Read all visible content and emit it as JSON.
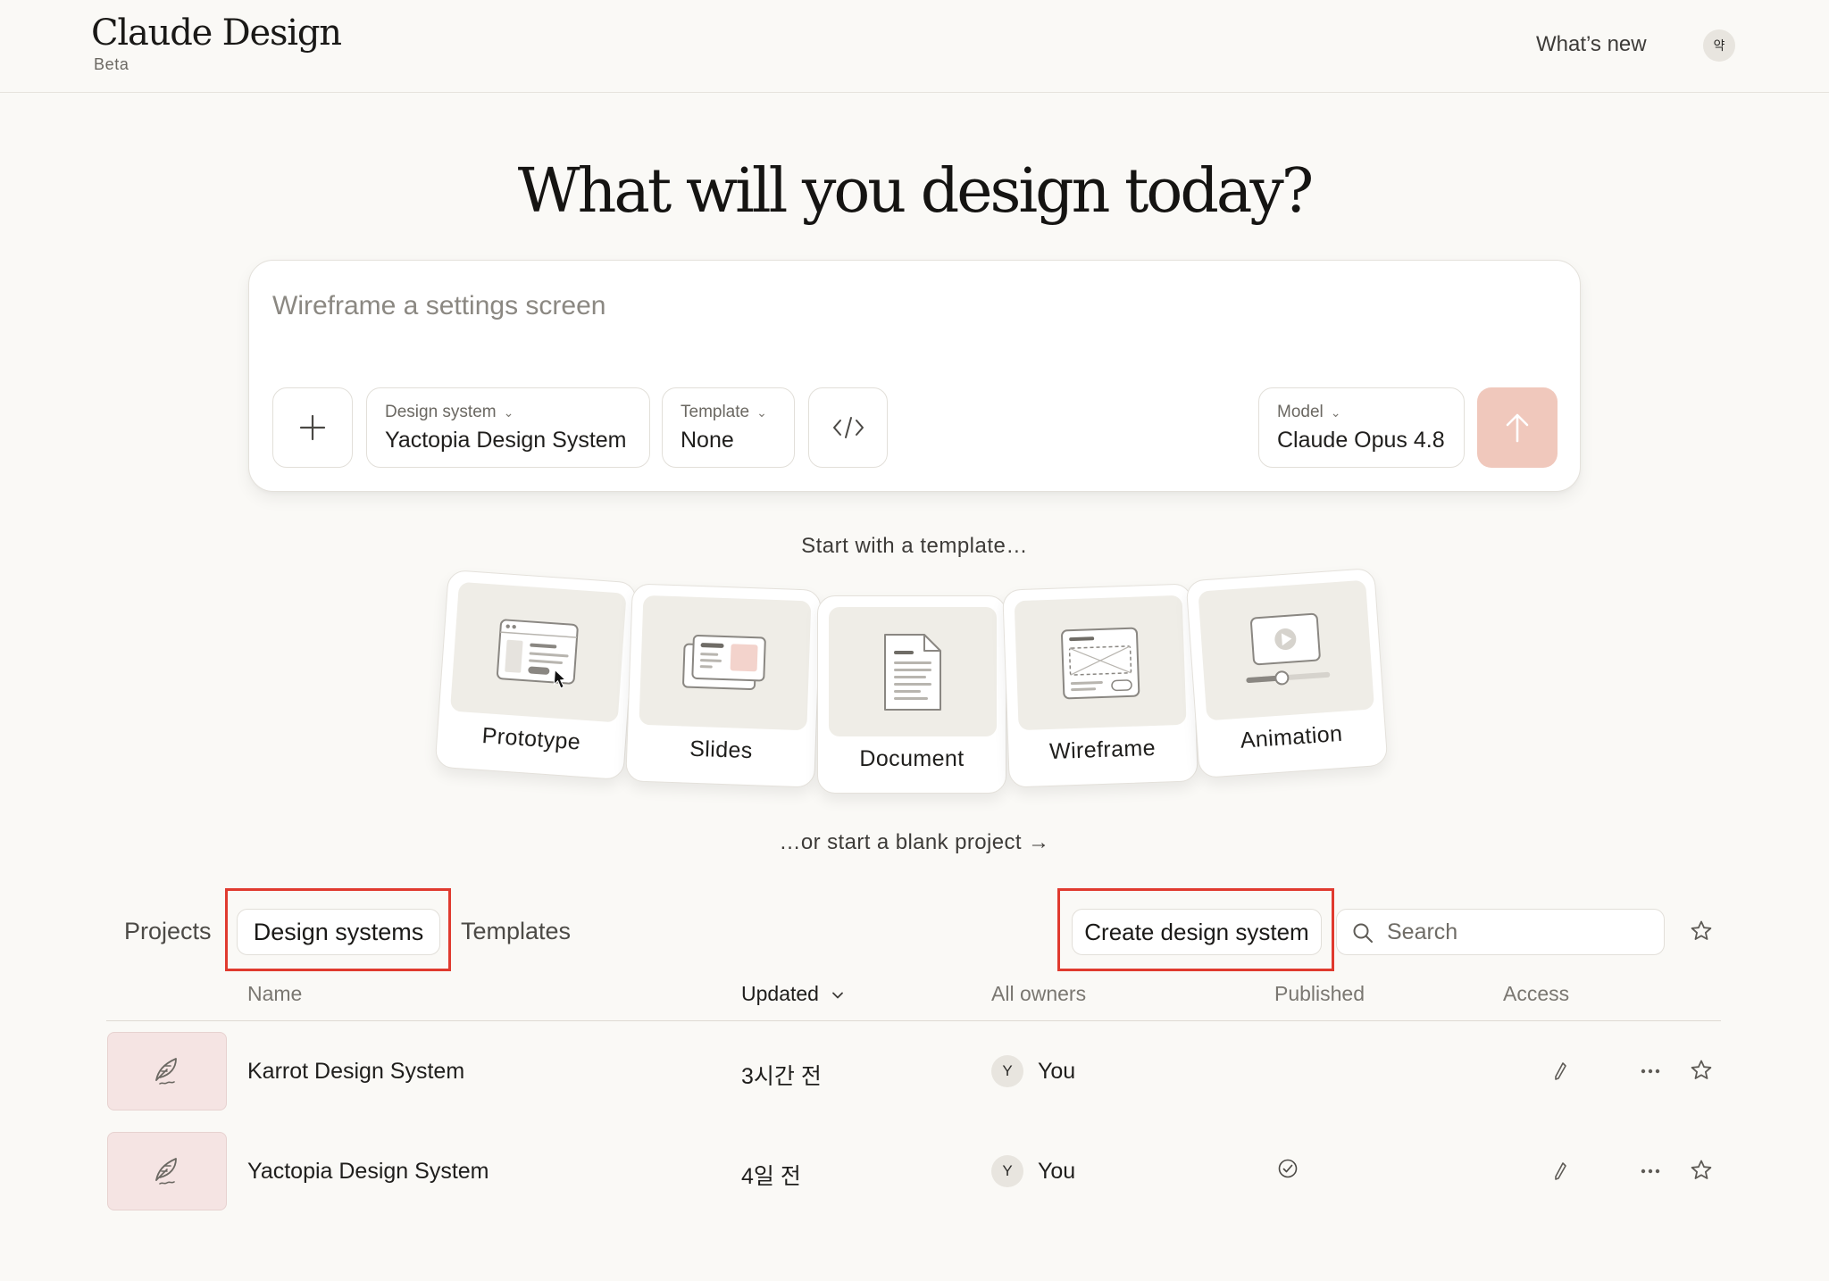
{
  "header": {
    "logo": "Claude Design",
    "badge": "Beta",
    "whats_new": "What’s new",
    "avatar_initial": "약"
  },
  "hero": {
    "title": "What will you design today?"
  },
  "prompt": {
    "placeholder": "Wireframe a settings screen",
    "design_system_label": "Design system",
    "design_system_value": "Yactopia Design System",
    "template_label": "Template",
    "template_value": "None",
    "model_label": "Model",
    "model_value": "Claude Opus 4.8",
    "send_color": "#f0c8bc"
  },
  "templates": {
    "heading": "Start with a template…",
    "items": [
      {
        "label": "Prototype",
        "icon": "prototype-icon"
      },
      {
        "label": "Slides",
        "icon": "slides-icon"
      },
      {
        "label": "Document",
        "icon": "document-icon"
      },
      {
        "label": "Wireframe",
        "icon": "wireframe-icon"
      },
      {
        "label": "Animation",
        "icon": "animation-icon"
      }
    ],
    "blank_link": "…or start a blank project →"
  },
  "tabs": {
    "items": [
      "Projects",
      "Design systems",
      "Templates"
    ],
    "active": "Design systems"
  },
  "toolbar": {
    "create_label": "Create design system",
    "search_placeholder": "Search",
    "highlight_color": "#e03a2f"
  },
  "table": {
    "columns": {
      "name": "Name",
      "updated": "Updated",
      "owners": "All owners",
      "published": "Published",
      "access": "Access"
    },
    "rows": [
      {
        "name": "Karrot Design System",
        "updated": "3시간 전",
        "owner_initial": "Y",
        "owner": "You",
        "published": false
      },
      {
        "name": "Yactopia Design System",
        "updated": "4일 전",
        "owner_initial": "Y",
        "owner": "You",
        "published": true
      }
    ]
  }
}
